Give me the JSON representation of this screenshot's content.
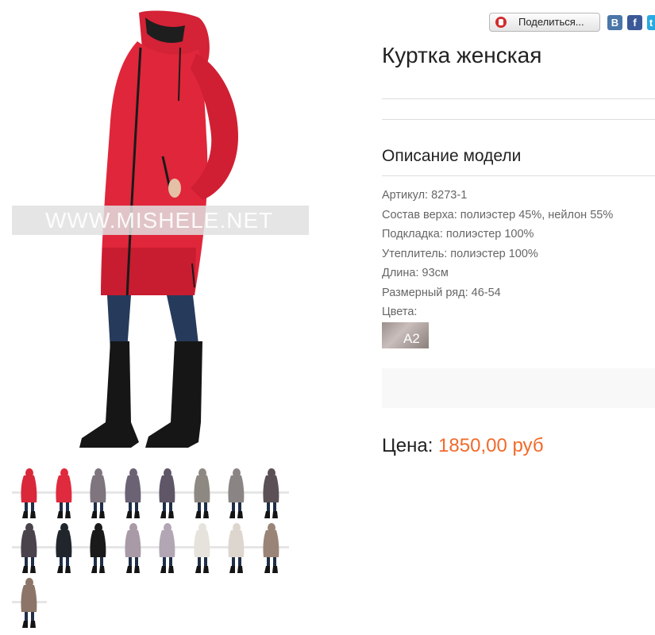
{
  "share": {
    "label": "Поделиться...",
    "icon": "share-icon",
    "networks": [
      {
        "name": "vk",
        "glyph": "В",
        "color": "#4a76a8"
      },
      {
        "name": "facebook",
        "glyph": "f",
        "color": "#3b5998"
      },
      {
        "name": "twitter",
        "glyph": "t",
        "color": "#29a9e1"
      }
    ]
  },
  "main_image": {
    "watermark": "WWW.MISHELE.NET",
    "coat_color": "#e0263a"
  },
  "thumbnails": [
    {
      "color": "#d9283a"
    },
    {
      "color": "#df2b3d"
    },
    {
      "color": "#7e757e"
    },
    {
      "color": "#6b6274"
    },
    {
      "color": "#5f5668"
    },
    {
      "color": "#8e8882"
    },
    {
      "color": "#8a8584"
    },
    {
      "color": "#5a5055"
    },
    {
      "color": "#4a434c"
    },
    {
      "color": "#20262b"
    },
    {
      "color": "#1a1a1a"
    },
    {
      "color": "#a99aa7"
    },
    {
      "color": "#b3a6b4"
    },
    {
      "color": "#e6e2dc"
    },
    {
      "color": "#ddd6cf"
    },
    {
      "color": "#9a8478"
    },
    {
      "color": "#8c7568"
    }
  ],
  "product": {
    "title": "Куртка женская",
    "description_title": "Описание модели",
    "specs": [
      "Артикул: 8273-1",
      "Состав верха: полиэстер 45%, нейлон 55%",
      "Подкладка: полиэстер 100%",
      "Утеплитель: полиэстер 100%",
      "Длина: 93см",
      "Размерный ряд: 46-54",
      "Цвета:"
    ],
    "color_swatch": "A2",
    "price_label": "Цена:",
    "price_value": "1850,00 руб",
    "price_color": "#f26a2b"
  }
}
